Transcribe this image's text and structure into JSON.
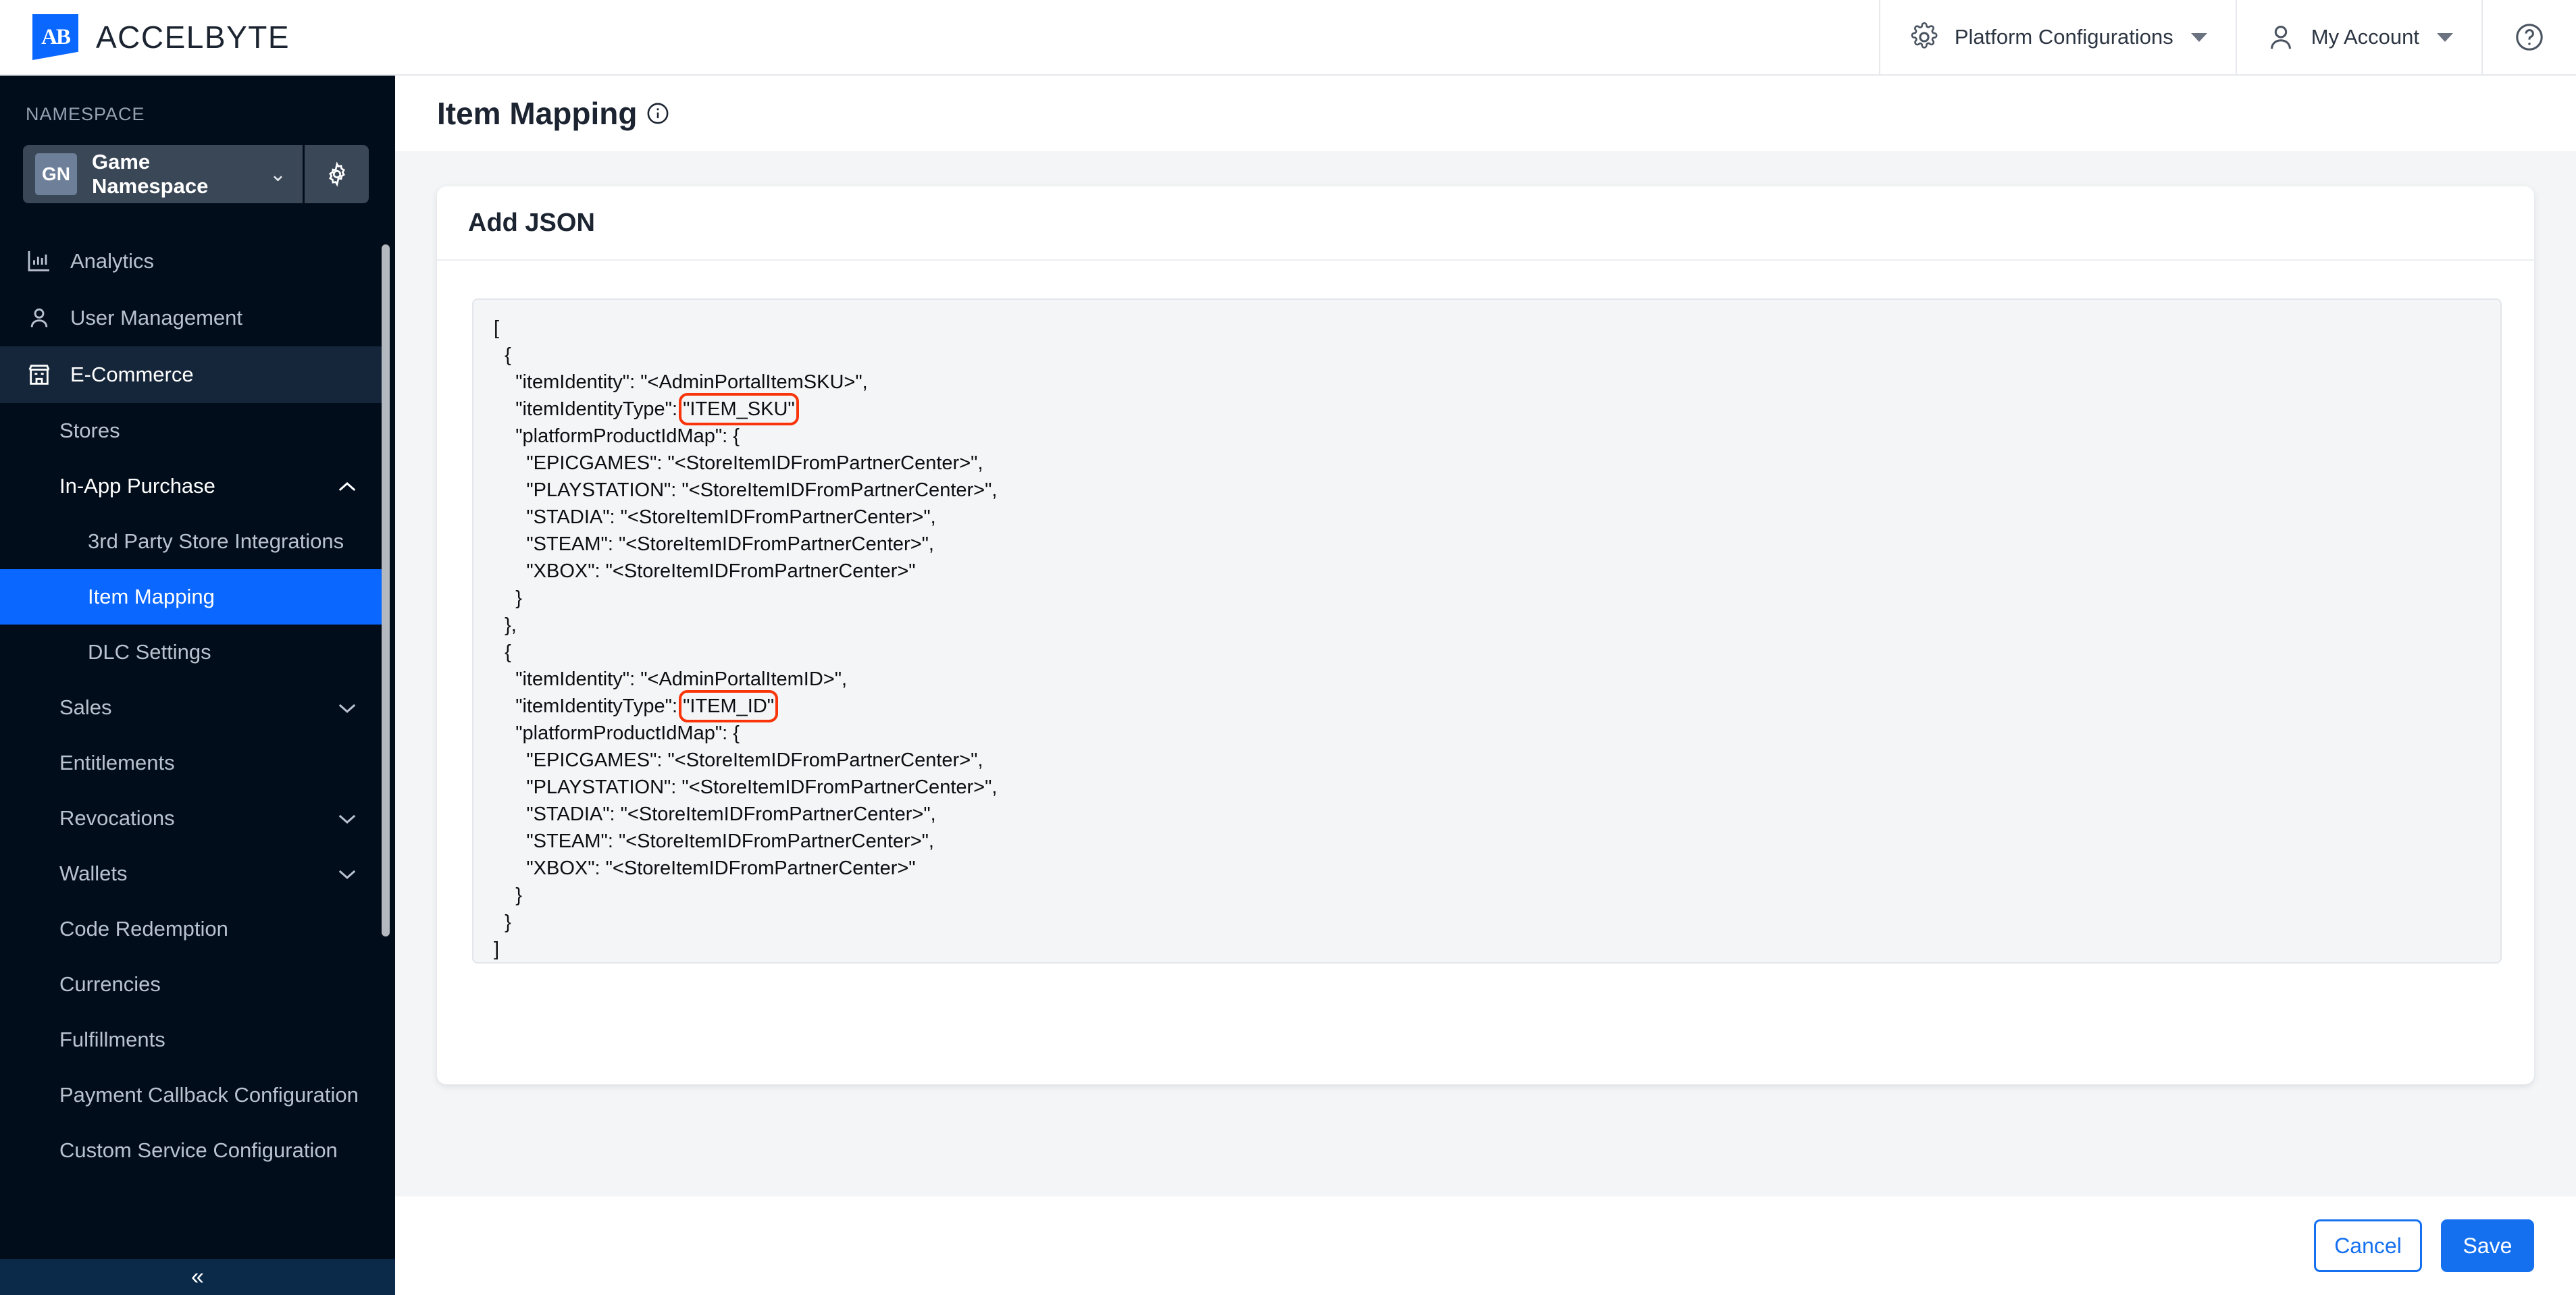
{
  "topbar": {
    "brand_mark": "AB",
    "brand_name": "ACCELBYTE",
    "platform_configurations": "Platform Configurations",
    "my_account": "My Account",
    "help_label": "?"
  },
  "sidebar": {
    "namespace_label": "NAMESPACE",
    "namespace_badge": "GN",
    "namespace_name": "Game Namespace",
    "items": [
      {
        "label": "Analytics",
        "icon": "chart-bar-icon",
        "level": 0,
        "state": "default",
        "caret": "none"
      },
      {
        "label": "User Management",
        "icon": "user-icon",
        "level": 0,
        "state": "default",
        "caret": "none"
      },
      {
        "label": "E-Commerce",
        "icon": "store-icon",
        "level": 0,
        "state": "section-active",
        "caret": "none"
      },
      {
        "label": "Stores",
        "icon": "none",
        "level": 1,
        "state": "default",
        "caret": "none"
      },
      {
        "label": "In-App Purchase",
        "icon": "none",
        "level": 1,
        "state": "open-group",
        "caret": "up"
      },
      {
        "label": "3rd Party Store Integrations",
        "icon": "none",
        "level": 2,
        "state": "default",
        "caret": "none"
      },
      {
        "label": "Item Mapping",
        "icon": "none",
        "level": 2,
        "state": "selected",
        "caret": "none"
      },
      {
        "label": "DLC Settings",
        "icon": "none",
        "level": 2,
        "state": "default",
        "caret": "none"
      },
      {
        "label": "Sales",
        "icon": "none",
        "level": 1,
        "state": "default",
        "caret": "down"
      },
      {
        "label": "Entitlements",
        "icon": "none",
        "level": 1,
        "state": "default",
        "caret": "none"
      },
      {
        "label": "Revocations",
        "icon": "none",
        "level": 1,
        "state": "default",
        "caret": "down"
      },
      {
        "label": "Wallets",
        "icon": "none",
        "level": 1,
        "state": "default",
        "caret": "down"
      },
      {
        "label": "Code Redemption",
        "icon": "none",
        "level": 1,
        "state": "default",
        "caret": "none"
      },
      {
        "label": "Currencies",
        "icon": "none",
        "level": 1,
        "state": "default",
        "caret": "none"
      },
      {
        "label": "Fulfillments",
        "icon": "none",
        "level": 1,
        "state": "default",
        "caret": "none"
      },
      {
        "label": "Payment Callback Configuration",
        "icon": "none",
        "level": 1,
        "state": "default",
        "caret": "none"
      },
      {
        "label": "Custom Service Configuration",
        "icon": "none",
        "level": 1,
        "state": "default",
        "caret": "none"
      }
    ],
    "collapse_glyph": "«"
  },
  "page": {
    "title": "Item Mapping",
    "card_title": "Add JSON"
  },
  "code": {
    "before_first_highlight": "[\n  {\n    \"itemIdentity\": \"<AdminPortalItemSKU>\",\n    \"itemIdentityType\": ",
    "highlight_1": "\"ITEM_SKU\"",
    "between_highlights": ",\n    \"platformProductIdMap\": {\n      \"EPICGAMES\": \"<StoreItemIDFromPartnerCenter>\",\n      \"PLAYSTATION\": \"<StoreItemIDFromPartnerCenter>\",\n      \"STADIA\": \"<StoreItemIDFromPartnerCenter>\",\n      \"STEAM\": \"<StoreItemIDFromPartnerCenter>\",\n      \"XBOX\": \"<StoreItemIDFromPartnerCenter>\"\n    }\n  },\n  {\n    \"itemIdentity\": \"<AdminPortalItemID>\",\n    \"itemIdentityType\": ",
    "highlight_2": "\"ITEM_ID\"",
    "after_last_highlight": ",\n    \"platformProductIdMap\": {\n      \"EPICGAMES\": \"<StoreItemIDFromPartnerCenter>\",\n      \"PLAYSTATION\": \"<StoreItemIDFromPartnerCenter>\",\n      \"STADIA\": \"<StoreItemIDFromPartnerCenter>\",\n      \"STEAM\": \"<StoreItemIDFromPartnerCenter>\",\n      \"XBOX\": \"<StoreItemIDFromPartnerCenter>\"\n    }\n  }\n]"
  },
  "footer": {
    "cancel_label": "Cancel",
    "save_label": "Save"
  },
  "colors": {
    "accent_blue": "#1570ef",
    "sidebar_bg": "#020d1b",
    "selected_nav": "#0a67ff",
    "highlight_red": "#f83408",
    "brand_blue": "#0a67ff"
  }
}
